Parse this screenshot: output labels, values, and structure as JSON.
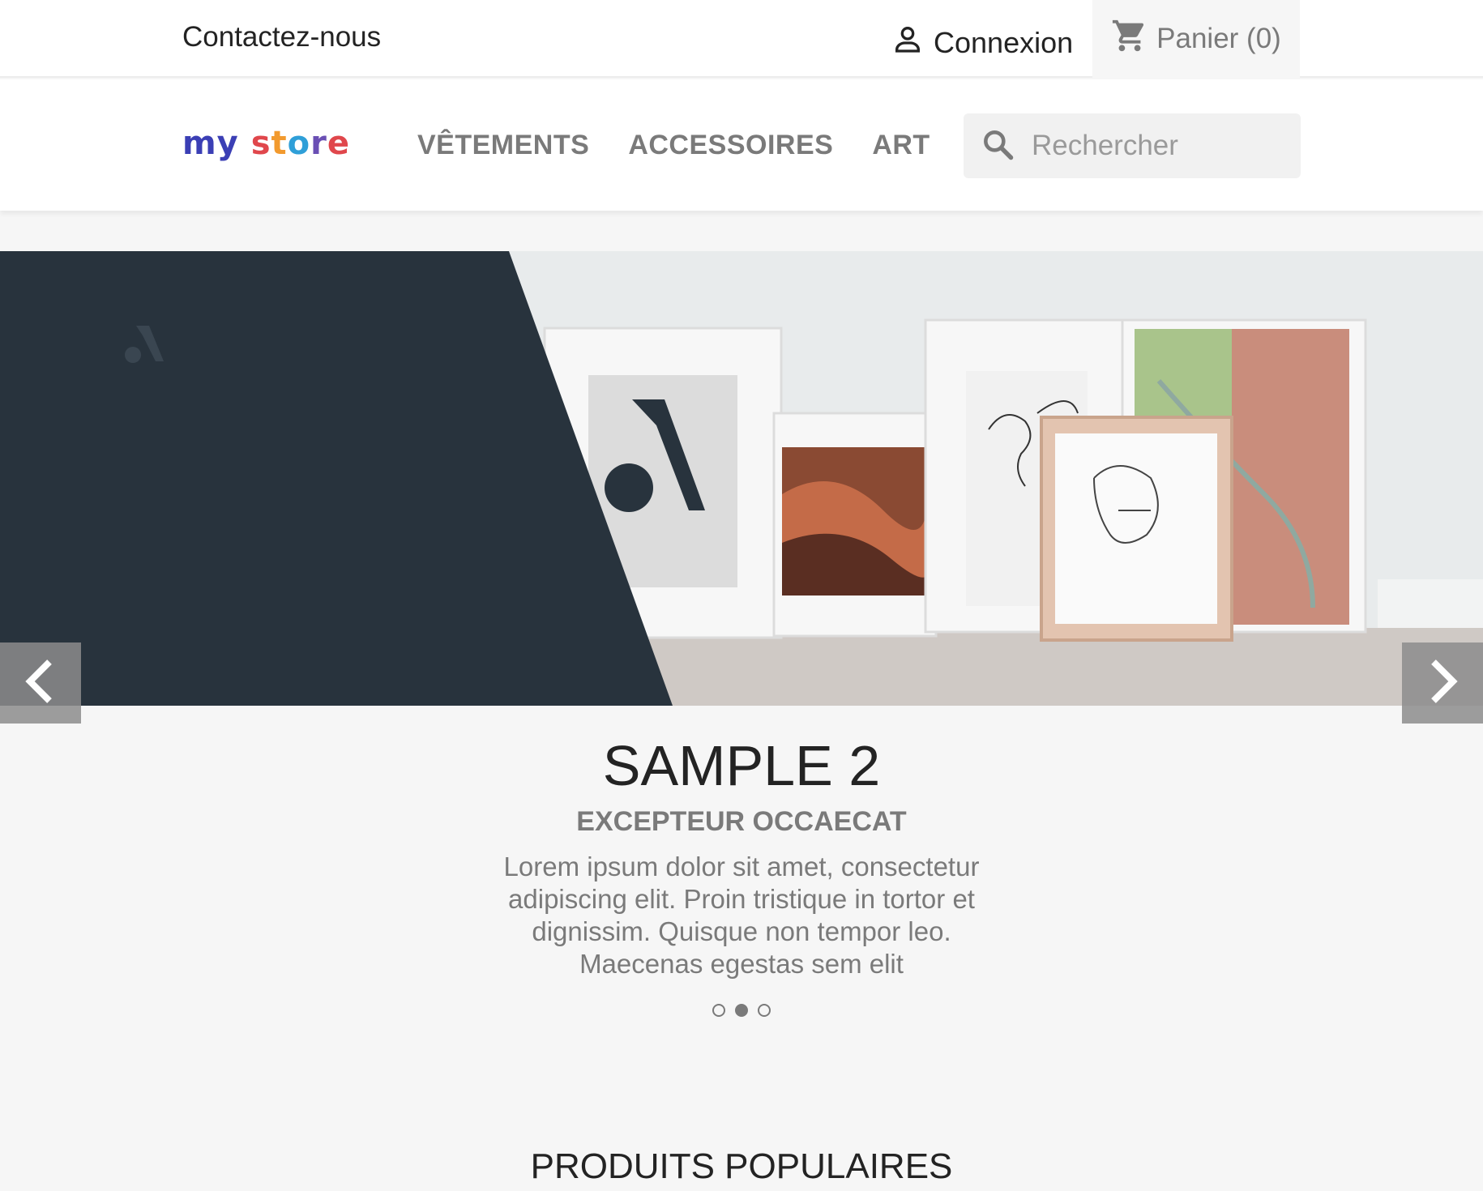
{
  "topbar": {
    "contact_label": "Contactez-nous",
    "login_label": "Connexion",
    "cart_label": "Panier (0)"
  },
  "header": {
    "logo_text": "my store",
    "nav": [
      {
        "label": "VÊTEMENTS"
      },
      {
        "label": "ACCESSOIRES"
      },
      {
        "label": "ART"
      }
    ],
    "search": {
      "placeholder": "Rechercher",
      "value": ""
    }
  },
  "slider": {
    "title": "SAMPLE 2",
    "subtitle": "EXCEPTEUR OCCAECAT",
    "text": "Lorem ipsum dolor sit amet, consectetur adipiscing elit. Proin tristique in tortor et dignissim. Quisque non tempor leo. Maecenas egestas sem elit",
    "active_slide": 2,
    "slide_count": 3
  },
  "section": {
    "title": "PRODUITS POPULAIRES"
  },
  "colors": {
    "dark_panel": "#28333d",
    "text_dark": "#232323",
    "text_muted": "#7a7a7a"
  }
}
